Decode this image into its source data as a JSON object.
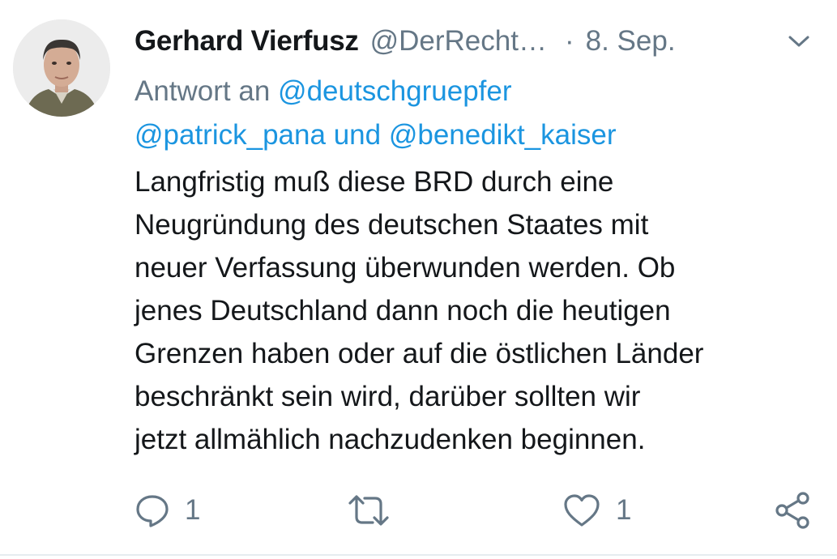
{
  "tweet": {
    "author_name": "Gerhard Vierfusz",
    "author_handle": "@DerRecht…",
    "separator": "·",
    "date": "8. Sep.",
    "reply_prefix": "Antwort an",
    "reply_mentions": [
      "@deutschgruepfer",
      "@patrick_pana",
      "@benedikt_kaiser"
    ],
    "reply_joiner": "und",
    "text": "Langfristig muß diese BRD durch eine\nNeugründung des deutschen Staates mit\nneuer Verfassung überwunden werden. Ob\njenes Deutschland dann noch die heutigen\nGrenzen haben oder auf die östlichen Länder\nbeschränkt sein wird, darüber sollten wir\njetzt allmählich nachzudenken beginnen.",
    "actions": {
      "reply_count": "1",
      "like_count": "1",
      "icons": [
        "reply-icon",
        "retweet-icon",
        "like-icon",
        "share-icon"
      ]
    }
  },
  "colors": {
    "text": "#14171a",
    "secondary": "#657786",
    "link": "#1b95e0"
  }
}
